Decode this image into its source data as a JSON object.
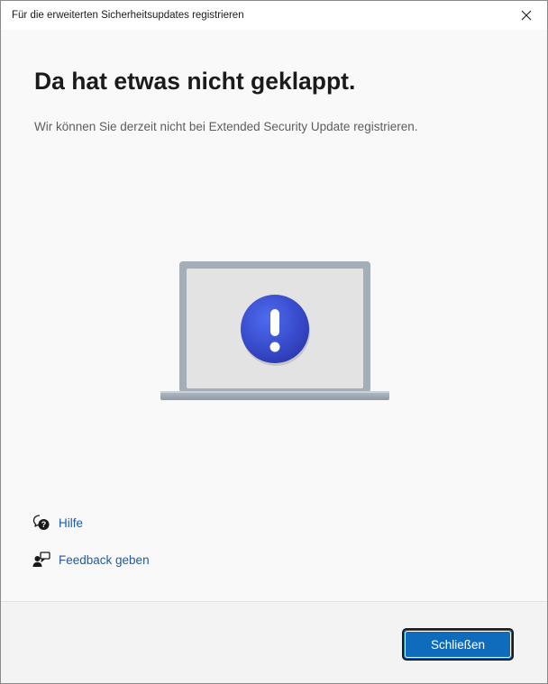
{
  "window": {
    "title": "Für die erweiterten Sicherheitsupdates registrieren",
    "close_icon": "close-icon"
  },
  "main": {
    "heading": "Da hat etwas nicht geklappt.",
    "message": "Wir können Sie derzeit nicht bei Extended Security Update registrieren.",
    "illustration_icon": "laptop-with-exclamation-icon"
  },
  "links": {
    "help": {
      "label": "Hilfe",
      "icon": "help-chat-icon"
    },
    "feedback": {
      "label": "Feedback geben",
      "icon": "feedback-icon"
    }
  },
  "footer": {
    "close_label": "Schließen"
  },
  "colors": {
    "accent": "#0f6cbd",
    "link": "#1c5aa8",
    "badge_blue": "#3b4fc7",
    "background": "#f9f9f9",
    "footer": "#f3f3f3"
  }
}
